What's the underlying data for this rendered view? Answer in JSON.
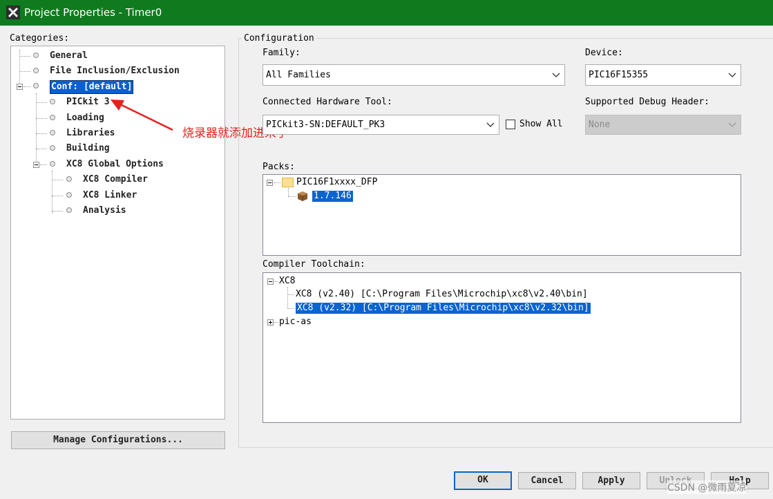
{
  "window": {
    "title": "Project Properties - Timer0",
    "accent": "#0f7b1e"
  },
  "categories": {
    "label": "Categories:",
    "items": [
      {
        "label": "General"
      },
      {
        "label": "File Inclusion/Exclusion"
      },
      {
        "label": "Conf: [default]"
      },
      {
        "label": "PICkit 3"
      },
      {
        "label": "Loading"
      },
      {
        "label": "Libraries"
      },
      {
        "label": "Building"
      },
      {
        "label": "XC8 Global Options"
      },
      {
        "label": "XC8 Compiler"
      },
      {
        "label": "XC8 Linker"
      },
      {
        "label": "Analysis"
      }
    ],
    "manage_button": "Manage Configurations..."
  },
  "config": {
    "group_title": "Configuration",
    "family_label": "Family:",
    "family_value": "All Families",
    "device_label": "Device:",
    "device_value": "PIC16F15355",
    "tool_label": "Connected Hardware Tool:",
    "tool_value": "PICkit3-SN:DEFAULT_PK3",
    "show_all_label": "Show All",
    "debug_header_label": "Supported Debug Header:",
    "debug_header_value": "None",
    "packs_label": "Packs:",
    "packs": {
      "root": "PIC16F1xxxx_DFP",
      "version": "1.7.146"
    },
    "toolchain_label": "Compiler Toolchain:",
    "toolchain": {
      "xc8_root": "XC8",
      "items": [
        "XC8 (v2.40) [C:\\Program Files\\Microchip\\xc8\\v2.40\\bin]",
        "XC8 (v2.32) [C:\\Program Files\\Microchip\\xc8\\v2.32\\bin]"
      ],
      "pic_as_root": "pic-as"
    }
  },
  "buttons": {
    "ok": "OK",
    "cancel": "Cancel",
    "apply": "Apply",
    "unlock": "Unlock",
    "help": "Help"
  },
  "annotation": {
    "text": "烧录器就添加进来了",
    "color": "#e8201d"
  },
  "watermark": "CSDN @微雨夏凉"
}
